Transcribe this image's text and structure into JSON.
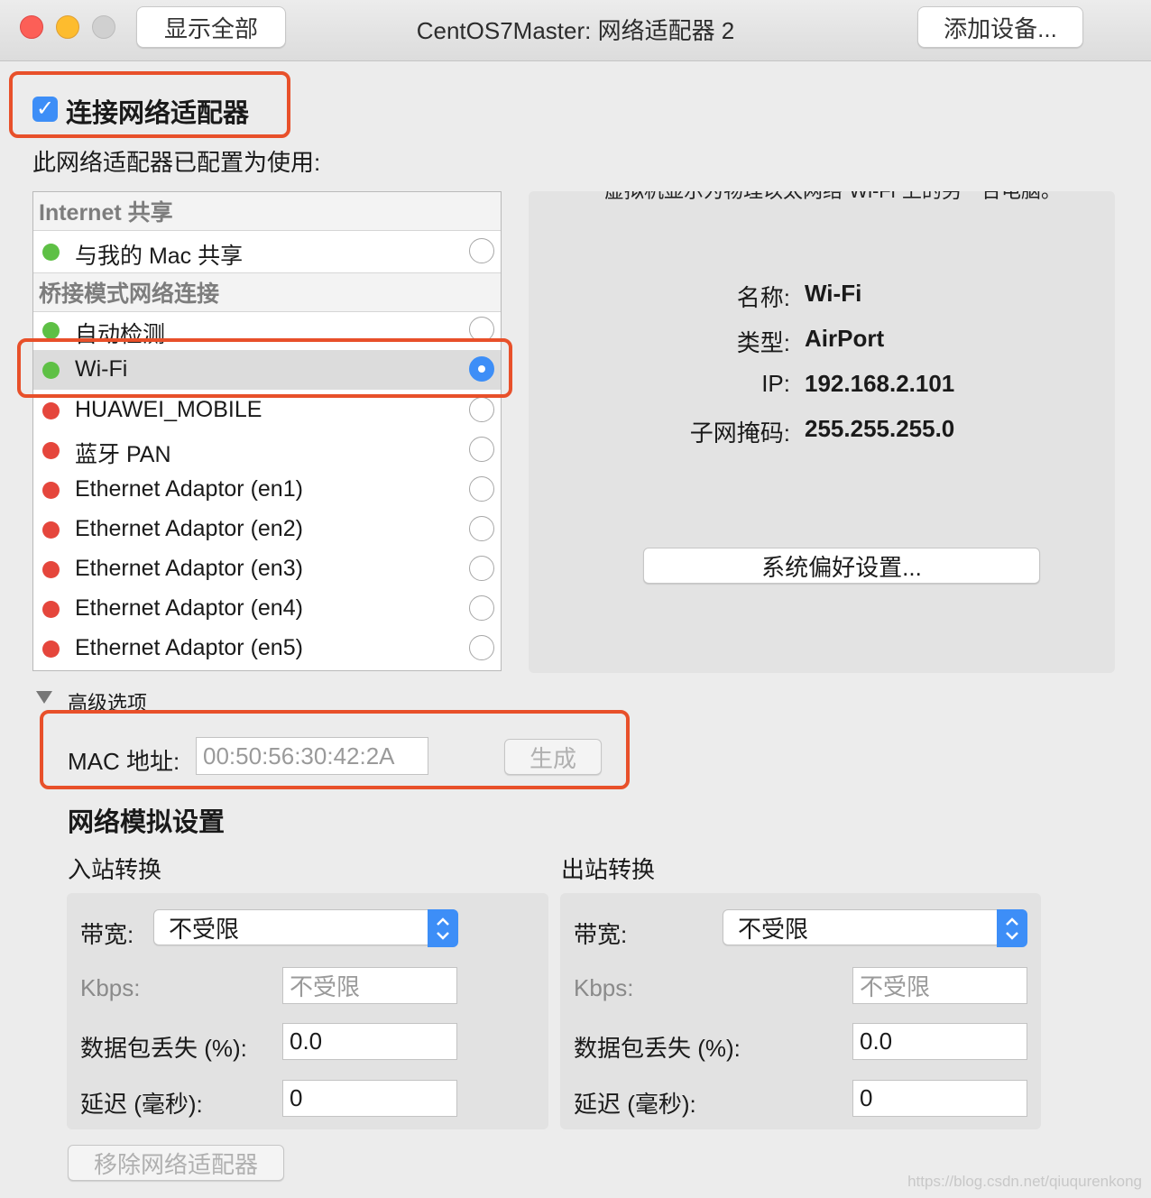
{
  "titlebar": {
    "title": "CentOS7Master: 网络适配器 2",
    "show_all_label": "显示全部",
    "add_device_label": "添加设备..."
  },
  "connect": {
    "label": "连接网络适配器",
    "checked": true
  },
  "configured_for_label": "此网络适配器已配置为使用:",
  "list": {
    "internet_header": "Internet 共享",
    "bridged_header": "桥接模式网络连接",
    "items": [
      {
        "label": "与我的 Mac 共享",
        "status": "green",
        "selected": false
      },
      {
        "label": "自动检测",
        "status": "green",
        "selected": false
      },
      {
        "label": "Wi-Fi",
        "status": "green",
        "selected": true
      },
      {
        "label": "HUAWEI_MOBILE",
        "status": "red",
        "selected": false
      },
      {
        "label": "蓝牙 PAN",
        "status": "red",
        "selected": false
      },
      {
        "label": "Ethernet Adaptor (en1)",
        "status": "red",
        "selected": false
      },
      {
        "label": "Ethernet Adaptor (en2)",
        "status": "red",
        "selected": false
      },
      {
        "label": "Ethernet Adaptor (en3)",
        "status": "red",
        "selected": false
      },
      {
        "label": "Ethernet Adaptor (en4)",
        "status": "red",
        "selected": false
      },
      {
        "label": "Ethernet Adaptor (en5)",
        "status": "red",
        "selected": false
      }
    ]
  },
  "info": {
    "description": "虚拟机显示为物理以太网络“Wi-Fi”上的另一台电脑。",
    "name_label": "名称:",
    "name_value": "Wi-Fi",
    "type_label": "类型:",
    "type_value": "AirPort",
    "ip_label": "IP:",
    "ip_value": "192.168.2.101",
    "subnet_label": "子网掩码:",
    "subnet_value": "255.255.255.0",
    "prefs_button": "系统偏好设置..."
  },
  "advanced": {
    "label": "高级选项",
    "mac_label": "MAC 地址:",
    "mac_value": "00:50:56:30:42:2A",
    "generate_label": "生成"
  },
  "simulation": {
    "title": "网络模拟设置",
    "inbound": {
      "title": "入站转换",
      "bandwidth_label": "带宽:",
      "bandwidth_value": "不受限",
      "kbps_label": "Kbps:",
      "kbps_value": "不受限",
      "loss_label": "数据包丢失 (%):",
      "loss_value": "0.0",
      "latency_label": "延迟 (毫秒):",
      "latency_value": "0"
    },
    "outbound": {
      "title": "出站转换",
      "bandwidth_label": "带宽:",
      "bandwidth_value": "不受限",
      "kbps_label": "Kbps:",
      "kbps_value": "不受限",
      "loss_label": "数据包丢失 (%):",
      "loss_value": "0.0",
      "latency_label": "延迟 (毫秒):",
      "latency_value": "0"
    }
  },
  "remove_label": "移除网络适配器",
  "watermark": "https://blog.csdn.net/qiuqurenkong",
  "colors": {
    "accent": "#3d8ef7",
    "status_green": "#5ec045",
    "status_red": "#e5463c",
    "annotation": "#e8502a"
  }
}
